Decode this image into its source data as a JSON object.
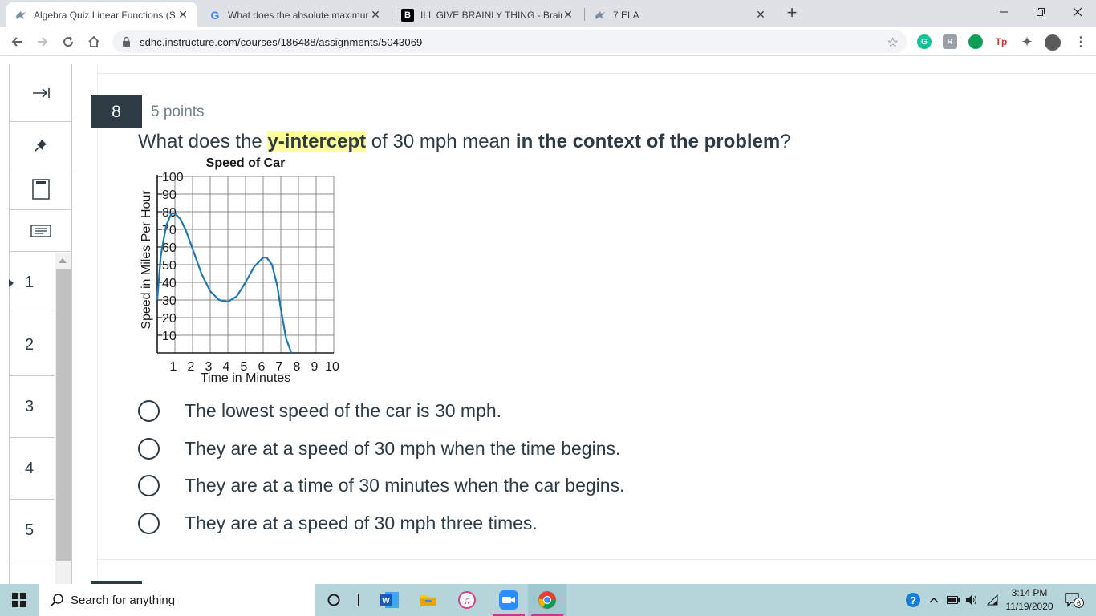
{
  "browser": {
    "tabs": [
      {
        "title": "Algebra Quiz Linear Functions (S",
        "active": true
      },
      {
        "title": "What does the absolute maximur",
        "active": false
      },
      {
        "title": "ILL GIVE BRAINLY THING - Brainly",
        "active": false
      },
      {
        "title": "7 ELA",
        "active": false
      }
    ],
    "url": "sdhc.instructure.com/courses/186488/assignments/5043069"
  },
  "leftnav": {
    "question_numbers": [
      "1",
      "2",
      "3",
      "4",
      "5"
    ]
  },
  "question": {
    "number": "8",
    "points": "5 points",
    "text_before": "What does the ",
    "text_highlight": "y-intercept",
    "text_middle": " of 30 mph mean ",
    "text_bold": "in the context of the problem",
    "text_after": "?",
    "answers": [
      "The lowest speed of the car is 30 mph.",
      "They are at a speed of 30 mph when the time begins.",
      "They are at a time of 30 minutes when the car begins.",
      "They are at a speed of 30 mph three times."
    ]
  },
  "chart_data": {
    "type": "line",
    "title": "Speed of Car",
    "xlabel": "Time in Minutes",
    "ylabel": "Speed in Miles Per Hour",
    "x_ticks": [
      "1",
      "2",
      "3",
      "4",
      "5",
      "6",
      "7",
      "8",
      "9",
      "10"
    ],
    "y_ticks": [
      "10",
      "20",
      "30",
      "40",
      "50",
      "60",
      "70",
      "80",
      "90",
      "100"
    ],
    "xlim": [
      0,
      10
    ],
    "ylim": [
      0,
      100
    ],
    "grid": true,
    "line_color": "#1f77b4",
    "series": [
      {
        "x": [
          0,
          0.2,
          0.5,
          0.8,
          1.0,
          1.3,
          1.6,
          2.0,
          2.5,
          3.0,
          3.5,
          4.0,
          4.5,
          5.0,
          5.5,
          6.0,
          6.2,
          6.5,
          6.8,
          7.0,
          7.3,
          7.6
        ],
        "y": [
          30,
          55,
          72,
          79,
          79,
          76,
          70,
          59,
          45,
          35,
          30,
          29,
          32,
          40,
          49,
          54,
          54,
          50,
          38,
          25,
          8,
          -5
        ]
      }
    ]
  },
  "taskbar": {
    "search_placeholder": "Search for anything",
    "time": "3:14 PM",
    "date": "11/19/2020",
    "notifications": "6"
  }
}
